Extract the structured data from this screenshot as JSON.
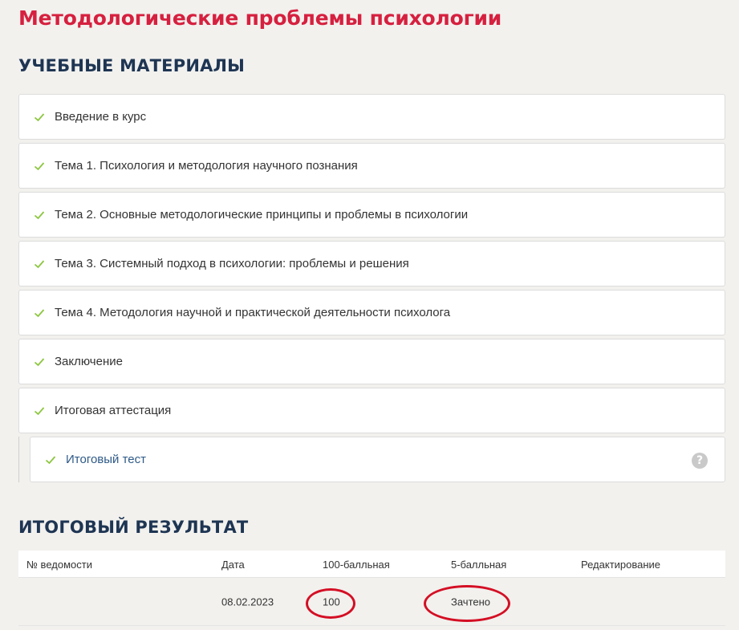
{
  "page": {
    "title": "Методологические проблемы психологии"
  },
  "materials": {
    "heading": "УЧЕБНЫЕ МАТЕРИАЛЫ",
    "items": [
      {
        "label": "Введение в курс",
        "icon": "check-icon",
        "status": "completed"
      },
      {
        "label": "Тема 1. Психология и методология научного познания",
        "icon": "check-icon",
        "status": "completed"
      },
      {
        "label": "Тема 2. Основные методологические принципы и проблемы в психологии",
        "icon": "check-icon",
        "status": "completed"
      },
      {
        "label": "Тема 3. Системный подход в психологии: проблемы и решения",
        "icon": "check-icon",
        "status": "completed"
      },
      {
        "label": "Тема 4. Методология научной и практической деятельности психолога",
        "icon": "check-icon",
        "status": "completed"
      },
      {
        "label": "Заключение",
        "icon": "check-icon",
        "status": "completed"
      },
      {
        "label": "Итоговая аттестация",
        "icon": "check-icon",
        "status": "completed"
      }
    ],
    "sub_item": {
      "label": "Итоговый тест",
      "icon": "check-icon",
      "help_icon": "question-icon",
      "help_glyph": "?"
    }
  },
  "result": {
    "heading": "ИТОГОВЫЙ РЕЗУЛЬТАТ",
    "columns": {
      "number": "№ ведомости",
      "date": "Дата",
      "score100": "100-балльная",
      "score5": "5-балльная",
      "edit": "Редактирование"
    },
    "rows": [
      {
        "number": "",
        "date": "08.02.2023",
        "score100": "100",
        "score5": "Зачтено",
        "edit": ""
      }
    ]
  },
  "colors": {
    "title_red": "#d6203f",
    "heading_navy": "#1e3553",
    "check_green": "#8cc63f",
    "link_blue": "#2e5a88",
    "annotation_red": "#d40f24",
    "background": "#f2f1ee"
  }
}
